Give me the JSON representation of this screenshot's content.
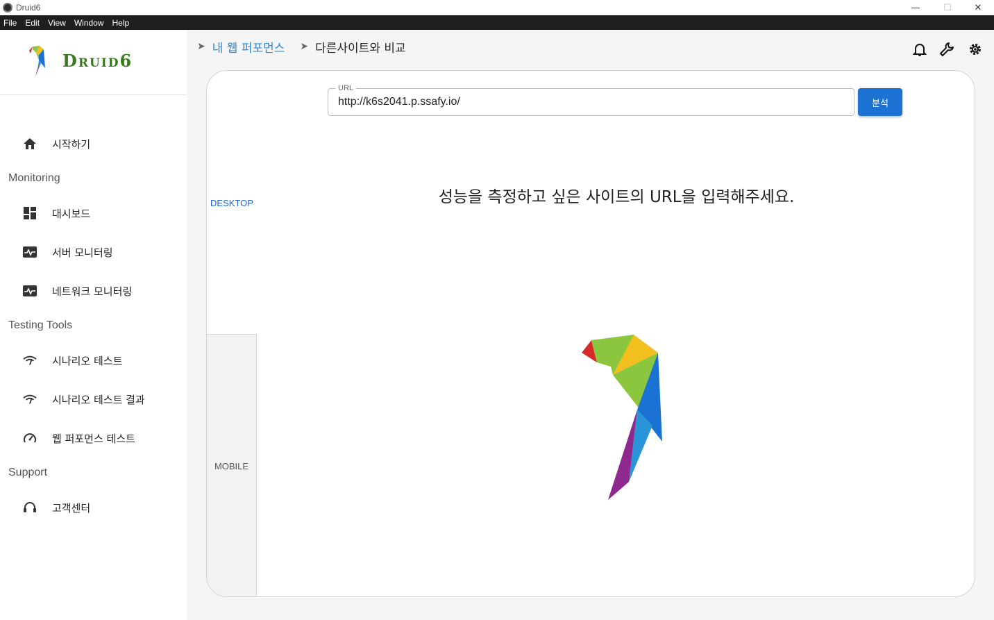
{
  "window": {
    "title": "Druid6",
    "minimize": "—",
    "maximize": "☐",
    "close": "✕"
  },
  "menu": [
    "File",
    "Edit",
    "View",
    "Window",
    "Help"
  ],
  "brand": {
    "name": "Druid6",
    "colors": {
      "green": "#3a7a1e",
      "blue": "#1c72d3",
      "red": "#d62b28",
      "yellow": "#f2c01e",
      "purple": "#8e2a8e"
    }
  },
  "sidebar": {
    "start": {
      "label": "시작하기",
      "icon": "home-icon"
    },
    "sections": [
      {
        "title": "Monitoring",
        "items": [
          {
            "label": "대시보드",
            "icon": "dashboard-icon"
          },
          {
            "label": "서버 모니터링",
            "icon": "monitor-heartbeat-icon"
          },
          {
            "label": "네트워크 모니터링",
            "icon": "monitor-heartbeat-icon"
          }
        ]
      },
      {
        "title": "Testing Tools",
        "items": [
          {
            "label": "시나리오 테스트",
            "icon": "wifi-signal-icon"
          },
          {
            "label": "시나리오 테스트 결과",
            "icon": "wifi-signal-icon"
          },
          {
            "label": "웹 퍼포먼스 테스트",
            "icon": "speedometer-icon"
          }
        ]
      },
      {
        "title": "Support",
        "items": [
          {
            "label": "고객센터",
            "icon": "headset-icon"
          }
        ]
      }
    ]
  },
  "breadcrumb": {
    "parent": "내 웹 퍼포먼스",
    "current": "다른사이트와 비교"
  },
  "header_icons": [
    "bell-icon",
    "wrench-icon",
    "settings-gear-icon"
  ],
  "tabs": {
    "desktop": "DESKTOP",
    "mobile": "MOBILE",
    "active": "DESKTOP"
  },
  "url": {
    "label": "URL",
    "value": "http://k6s2041.p.ssafy.io/"
  },
  "analyze_button": "분석",
  "prompt": "성능을 측정하고 싶은 사이트의 URL을 입력해주세요."
}
